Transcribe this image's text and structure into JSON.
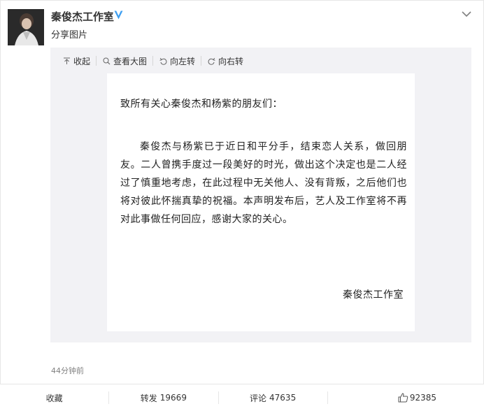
{
  "post": {
    "username": "秦俊杰工作室",
    "subtitle": "分享图片",
    "timestamp": "44分钟前"
  },
  "toolbar": {
    "collapse": "收起",
    "view_large": "查看大图",
    "rotate_left": "向左转",
    "rotate_right": "向右转"
  },
  "document": {
    "greeting": "致所有关心秦俊杰和杨紫的朋友们：",
    "body": "秦俊杰与杨紫已于近日和平分手，结束恋人关系，做回朋友。二人曾携手度过一段美好的时光，做出这个决定也是二人经过了慎重地考虑，在此过程中无关他人、没有背叛，之后他们也将对彼此怀揣真挚的祝福。本声明发布后，艺人及工作室将不再对此事做任何回应，感谢大家的关心。",
    "signature": "秦俊杰工作室"
  },
  "actions": {
    "favorite_label": "收藏",
    "repost_label": "转发",
    "repost_count": "19669",
    "comment_label": "评论",
    "comment_count": "47635",
    "like_count": "92385"
  },
  "colors": {
    "verified": "#3e9ff1",
    "background": "#f2f2f5",
    "text": "#333333",
    "meta": "#808080"
  },
  "icons": [
    "chevron-down-icon",
    "verified-icon",
    "collapse-icon",
    "zoom-icon",
    "rotate-left-icon",
    "rotate-right-icon",
    "thumb-up-icon"
  ]
}
